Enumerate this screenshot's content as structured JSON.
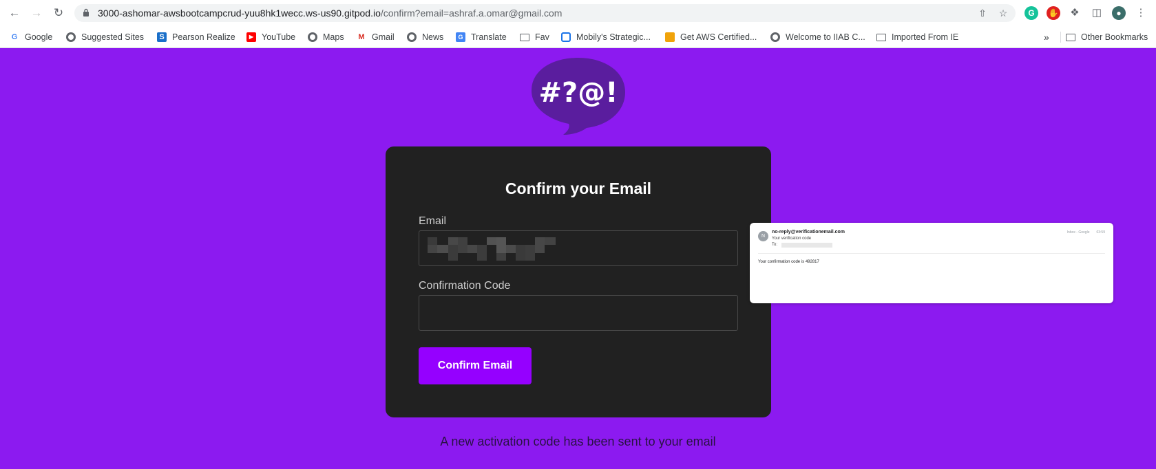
{
  "browser": {
    "url_host": "3000-ashomar-awsbootcampcrud-yuu8hk1wecc.ws-us90.gitpod.io",
    "url_path": "/confirm?email=ashraf.a.omar@gmail.com",
    "bookmarks": [
      {
        "label": "Google",
        "icon": "google-icon"
      },
      {
        "label": "Suggested Sites",
        "icon": "globe-icon"
      },
      {
        "label": "Pearson Realize",
        "icon": "pearson-icon"
      },
      {
        "label": "YouTube",
        "icon": "youtube-icon"
      },
      {
        "label": "Maps",
        "icon": "globe-icon"
      },
      {
        "label": "Gmail",
        "icon": "gmail-icon"
      },
      {
        "label": "News",
        "icon": "globe-icon"
      },
      {
        "label": "Translate",
        "icon": "translate-icon"
      },
      {
        "label": "Fav",
        "icon": "folder-icon"
      },
      {
        "label": "Mobily's Strategic...",
        "icon": "mobily-icon"
      },
      {
        "label": "Get AWS Certified...",
        "icon": "aws-icon"
      },
      {
        "label": "Welcome to IIAB C...",
        "icon": "globe-icon"
      },
      {
        "label": "Imported From IE",
        "icon": "folder-icon"
      }
    ],
    "overflow_label": "»",
    "other_bookmarks": "Other Bookmarks"
  },
  "logo": {
    "text": "#?@!"
  },
  "form": {
    "title": "Confirm your Email",
    "email_label": "Email",
    "code_label": "Confirmation Code",
    "code_value": "",
    "submit_label": "Confirm Email"
  },
  "status_message": "A new activation code has been sent to your email",
  "email_preview": {
    "avatar_letter": "N",
    "from": "no-reply@verificationemail.com",
    "subject": "Your verification code",
    "to_label": "To:",
    "meta_folder": "Inbox - Google",
    "meta_time": "03:59",
    "body": "Your confirmation code is 492817"
  },
  "colors": {
    "page_background": "#8c1af0",
    "card_background": "#212121",
    "button": "#9500ff",
    "logo_bubble": "#5a1d9e"
  }
}
